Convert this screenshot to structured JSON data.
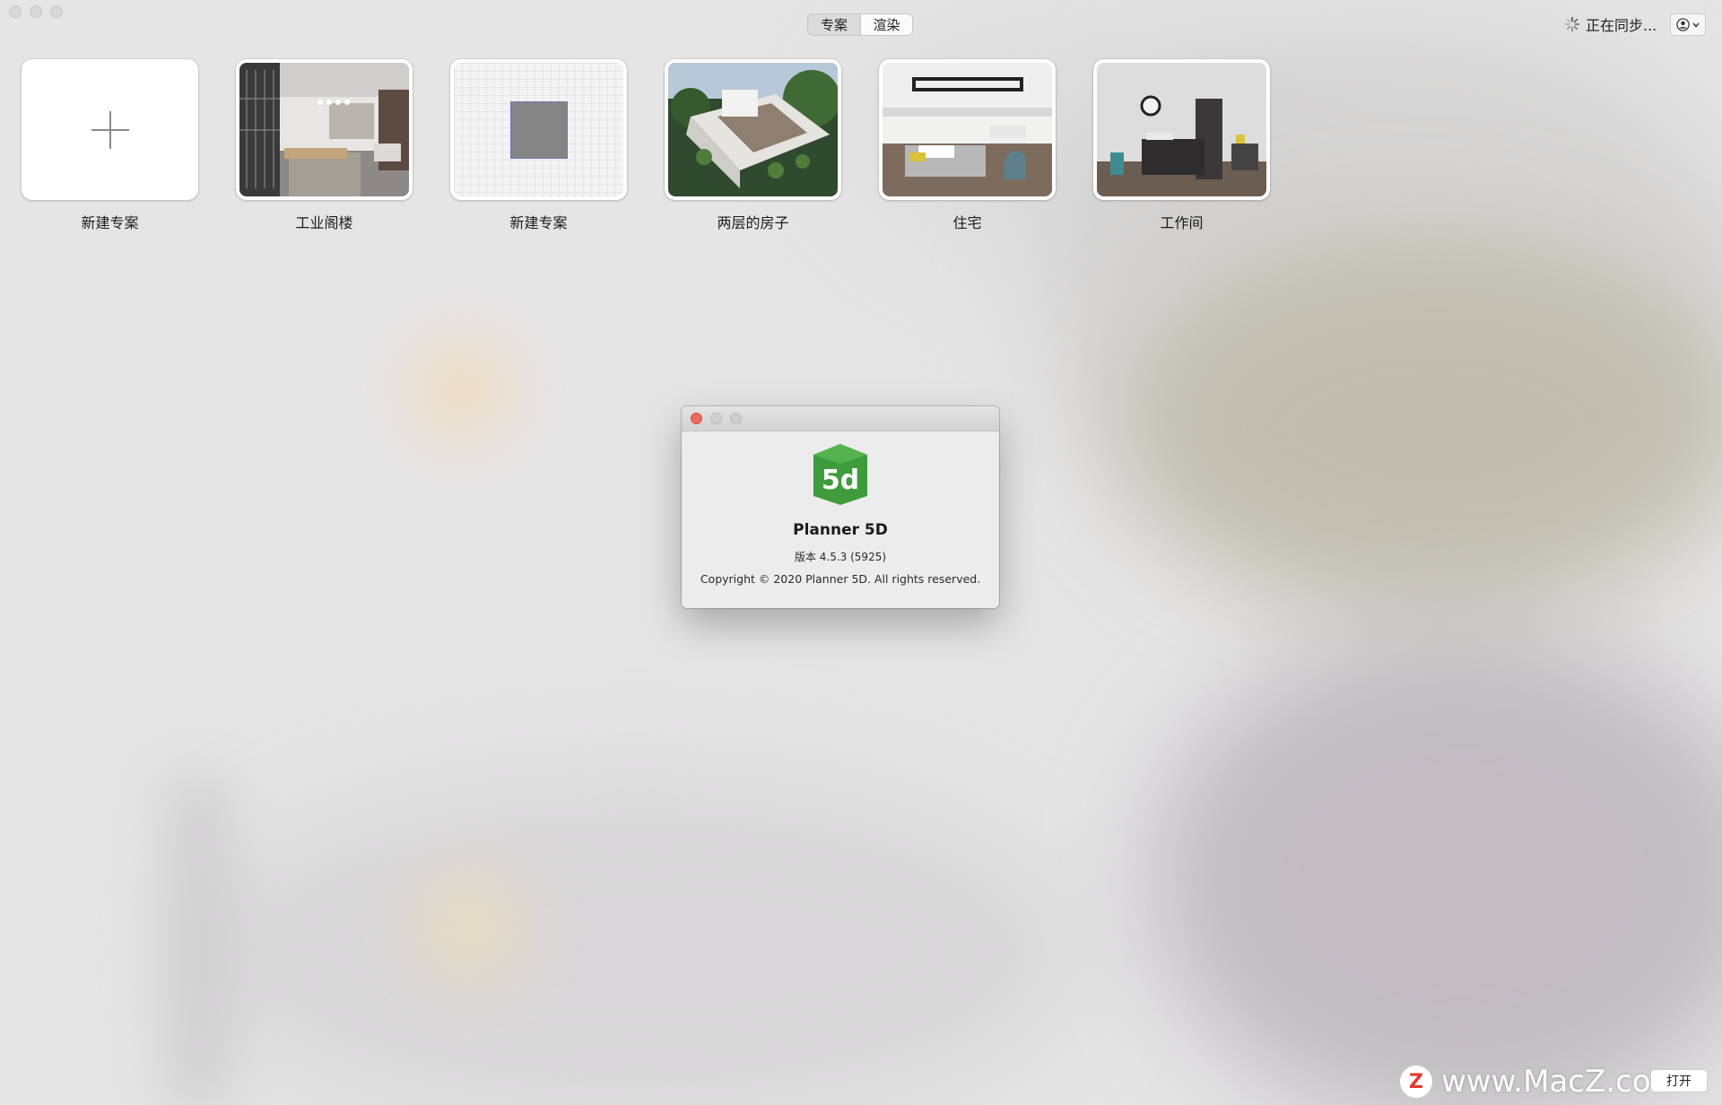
{
  "header": {
    "tabs": [
      {
        "label": "专案",
        "active": false
      },
      {
        "label": "渲染",
        "active": true
      }
    ],
    "sync_status": "正在同步...",
    "spinner_icon": "spinner-icon",
    "account_icon": "user-icon"
  },
  "projects": [
    {
      "label": "新建专案",
      "thumbnail": "plus-icon"
    },
    {
      "label": "工业阁楼",
      "thumbnail": "industrial-loft-render"
    },
    {
      "label": "新建专案",
      "thumbnail": "blank-floorplan"
    },
    {
      "label": "两层的房子",
      "thumbnail": "two-story-house-render"
    },
    {
      "label": "住宅",
      "thumbnail": "residence-render"
    },
    {
      "label": "工作间",
      "thumbnail": "workroom-render"
    }
  ],
  "about": {
    "app_name": "Planner 5D",
    "version": "版本 4.5.3 (5925)",
    "copyright": "Copyright © 2020 Planner 5D. All rights reserved.",
    "logo_text": "5d",
    "logo_color": "#3f9b3c"
  },
  "footer": {
    "open_button": "打开",
    "watermark_text": "www.MacZ.com",
    "watermark_logo": "Z"
  }
}
